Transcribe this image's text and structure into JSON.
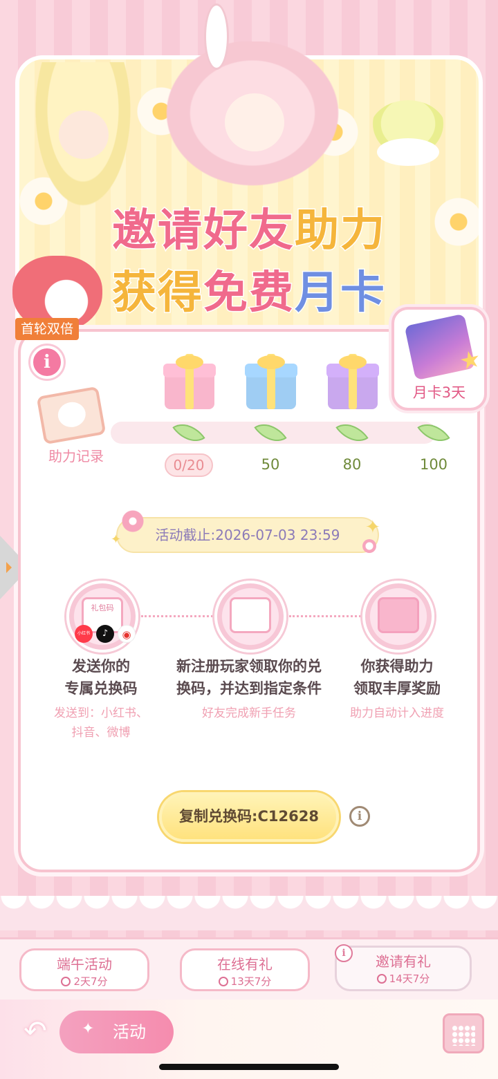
{
  "banner": {
    "title_line1": [
      {
        "text": "邀请好友",
        "color": "#f06a8c"
      },
      {
        "text": "助力",
        "color": "#f5b53b"
      }
    ],
    "title_line2": [
      {
        "text": "获得",
        "color": "#f5b53b"
      },
      {
        "text": "免费",
        "color": "#f06a8c"
      },
      {
        "text": "月卡",
        "color": "#6f8fe2"
      }
    ],
    "double_tag": "首轮双倍"
  },
  "progress": {
    "record_label": "助力记录",
    "current": "0/20",
    "current_value": 0,
    "milestones": [
      "50",
      "80",
      "100"
    ],
    "final_reward": "月卡3天"
  },
  "deadline": "活动截止:2026-07-03 23:59",
  "steps": [
    {
      "icon_text": "礼包码",
      "platforms": [
        "小红书",
        "♪",
        "◉"
      ],
      "title": [
        "发送你的",
        "专属兑换码"
      ],
      "sub": [
        "发送到：小红书、",
        "抖音、微博"
      ]
    },
    {
      "title": [
        "新注册玩家领取你的兑",
        "换码，并达到指定条件"
      ],
      "sub": [
        "好友完成新手任务"
      ]
    },
    {
      "title": [
        "你获得助力",
        "领取丰厚奖励"
      ],
      "sub": [
        "助力自动计入进度"
      ]
    }
  ],
  "copy_button": "复制兑换码:C12628",
  "tabs": [
    {
      "label": "端午活动",
      "time": "2天7分"
    },
    {
      "label": "在线有礼",
      "time": "13天7分"
    },
    {
      "label": "邀请有礼",
      "time": "14天7分"
    }
  ],
  "nav": {
    "activity_label": "活动"
  },
  "colors": {
    "accent_pink": "#f06a8c",
    "accent_gold": "#f5b53b",
    "accent_blue": "#6f8fe2"
  }
}
